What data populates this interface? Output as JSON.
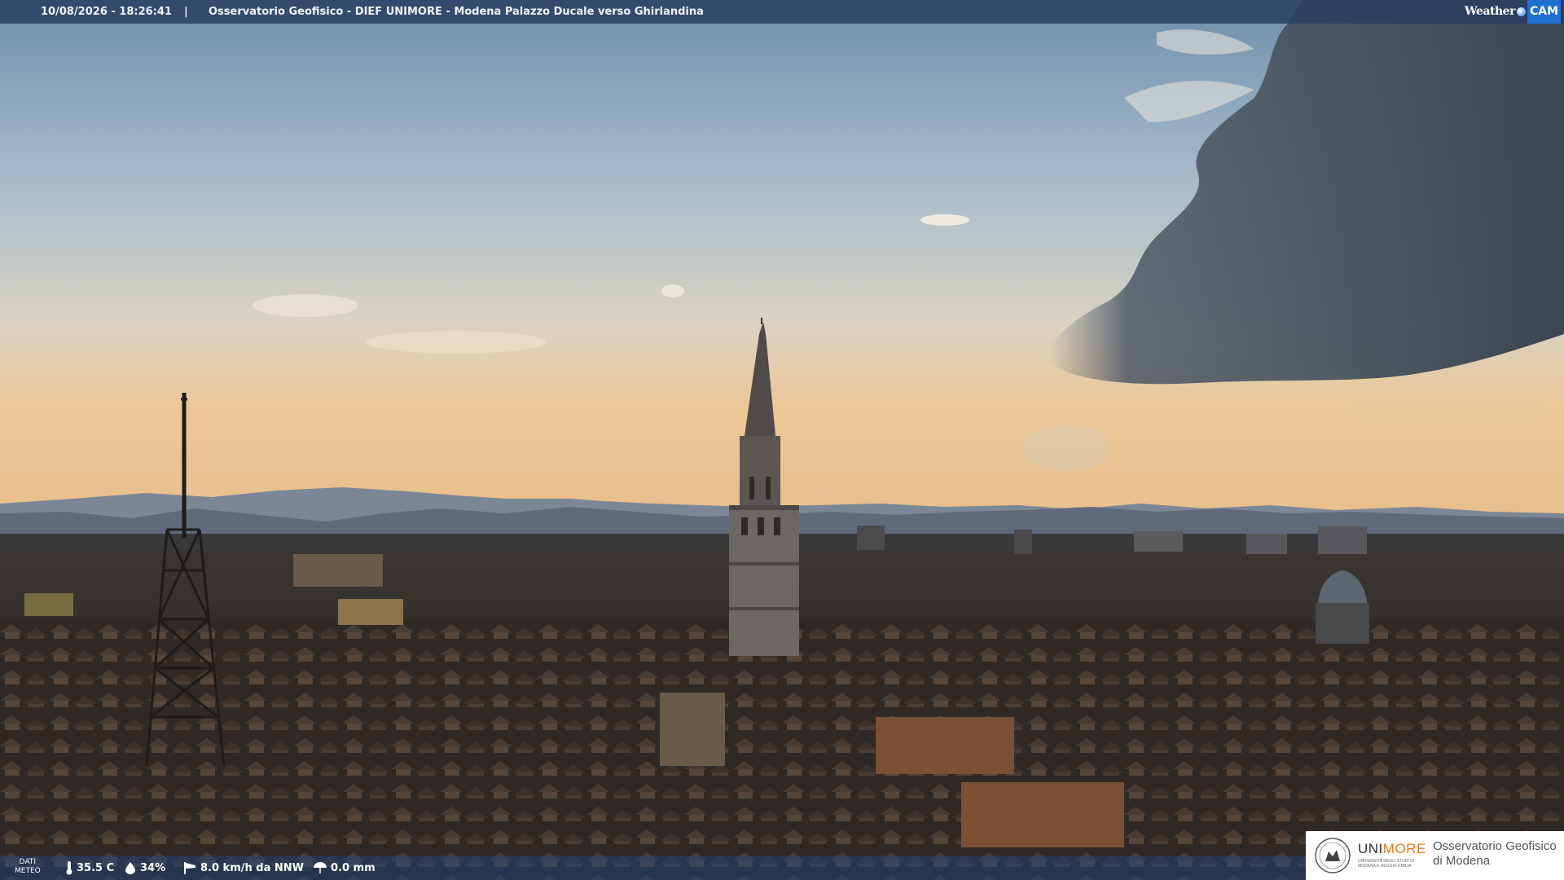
{
  "header": {
    "timestamp": "10/08/2026 - 18:26:41",
    "separator": "|",
    "camera_title": "Osservatorio Geofisico - DIEF UNIMORE - Modena Palazzo Ducale verso Ghirlandina"
  },
  "brand": {
    "weather": "Weather",
    "cam": "CAM"
  },
  "meteo": {
    "label_line1": "DATI",
    "label_line2": "METEO",
    "temperature": "35.5 C",
    "humidity": "34%",
    "wind": "8.0 km/h da NNW",
    "rain": "0.0 mm",
    "icons": [
      "thermometer-icon",
      "humidity-drop-icon",
      "wind-sock-icon",
      "umbrella-icon"
    ]
  },
  "logo": {
    "uni_part1": "UNI",
    "uni_part2": "MORE",
    "uni_subtitle": "UNIVERSITÀ DEGLI STUDI DI MODENA E REGGIO EMILIA",
    "observatory_line1": "Osservatorio Geofisico",
    "observatory_line2": "di Modena"
  },
  "colors": {
    "sky_top": "#7e9bb6",
    "sky_horizon": "#e9c79a",
    "storm_cloud": "#3f4d5c",
    "city": "#2e2824",
    "bar_blue": "#283e60",
    "logo_orange": "#e07a1f"
  }
}
